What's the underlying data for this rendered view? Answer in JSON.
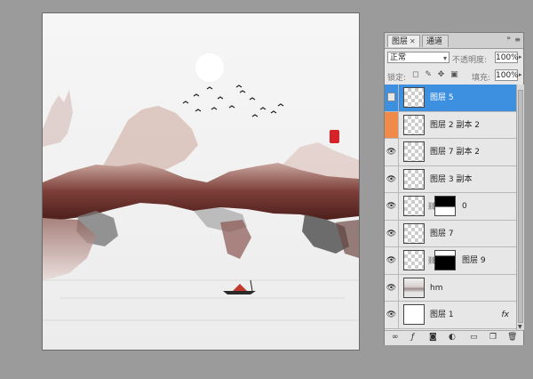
{
  "panel": {
    "tabs": [
      {
        "label": "图层"
      },
      {
        "label": "通道"
      }
    ],
    "blend_mode": "正常",
    "opacity_label": "不透明度:",
    "opacity_value": "100%",
    "lock_label": "锁定:",
    "fill_label": "填充:",
    "fill_value": "100%",
    "layers": [
      {
        "name": "图层 5",
        "selected": true
      },
      {
        "name": "图层 2 副本 2"
      },
      {
        "name": "图层 7 副本 2"
      },
      {
        "name": "图层 3 副本"
      },
      {
        "name": "0"
      },
      {
        "name": "图层 7"
      },
      {
        "name": "图层 9"
      },
      {
        "name": "hm"
      },
      {
        "name": "图层 1",
        "fx": "fx"
      }
    ]
  },
  "colors": {
    "selection": "#3d8fe0",
    "seal_red": "#d6232a",
    "ink_brown": "#6e3a34"
  }
}
